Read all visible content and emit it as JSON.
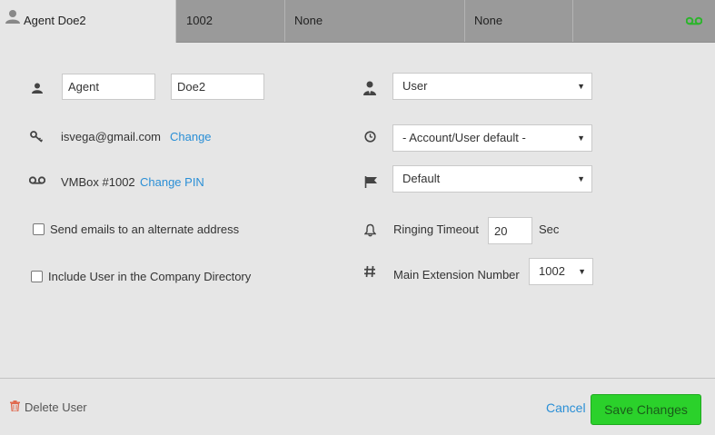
{
  "tabs": [
    {
      "label": "Agent Doe2"
    },
    {
      "label": "1002"
    },
    {
      "label": "None"
    },
    {
      "label": "None"
    }
  ],
  "form": {
    "first_name": "Agent",
    "last_name": "Doe2",
    "email": "isvega@gmail.com",
    "change_email_label": "Change",
    "vmbox_label": "VMBox #1002",
    "change_pin_label": "Change PIN",
    "send_alternate_label": "Send emails to an alternate address",
    "include_directory_label": "Include User in the Company Directory",
    "role_select": "User",
    "timezone_select": "- Account/User default -",
    "music_select": "Default",
    "ringing_timeout_label": "Ringing Timeout",
    "ringing_timeout_value": "20",
    "ringing_timeout_unit": "Sec",
    "main_extension_label": "Main Extension Number",
    "main_extension_value": "1002"
  },
  "footer": {
    "delete_label": "Delete User",
    "cancel_label": "Cancel",
    "save_label": "Save Changes"
  },
  "colors": {
    "link": "#2a8fd6",
    "save_button": "#2bd12b",
    "delete_icon": "#e06a50",
    "voicemail_tab_icon": "#2bb52b"
  },
  "icons": [
    "user-icon",
    "person-icon",
    "key-icon",
    "voicemail-icon",
    "user-tie-icon",
    "clock-icon",
    "flag-icon",
    "bell-icon",
    "hashtag-icon",
    "trash-icon"
  ]
}
